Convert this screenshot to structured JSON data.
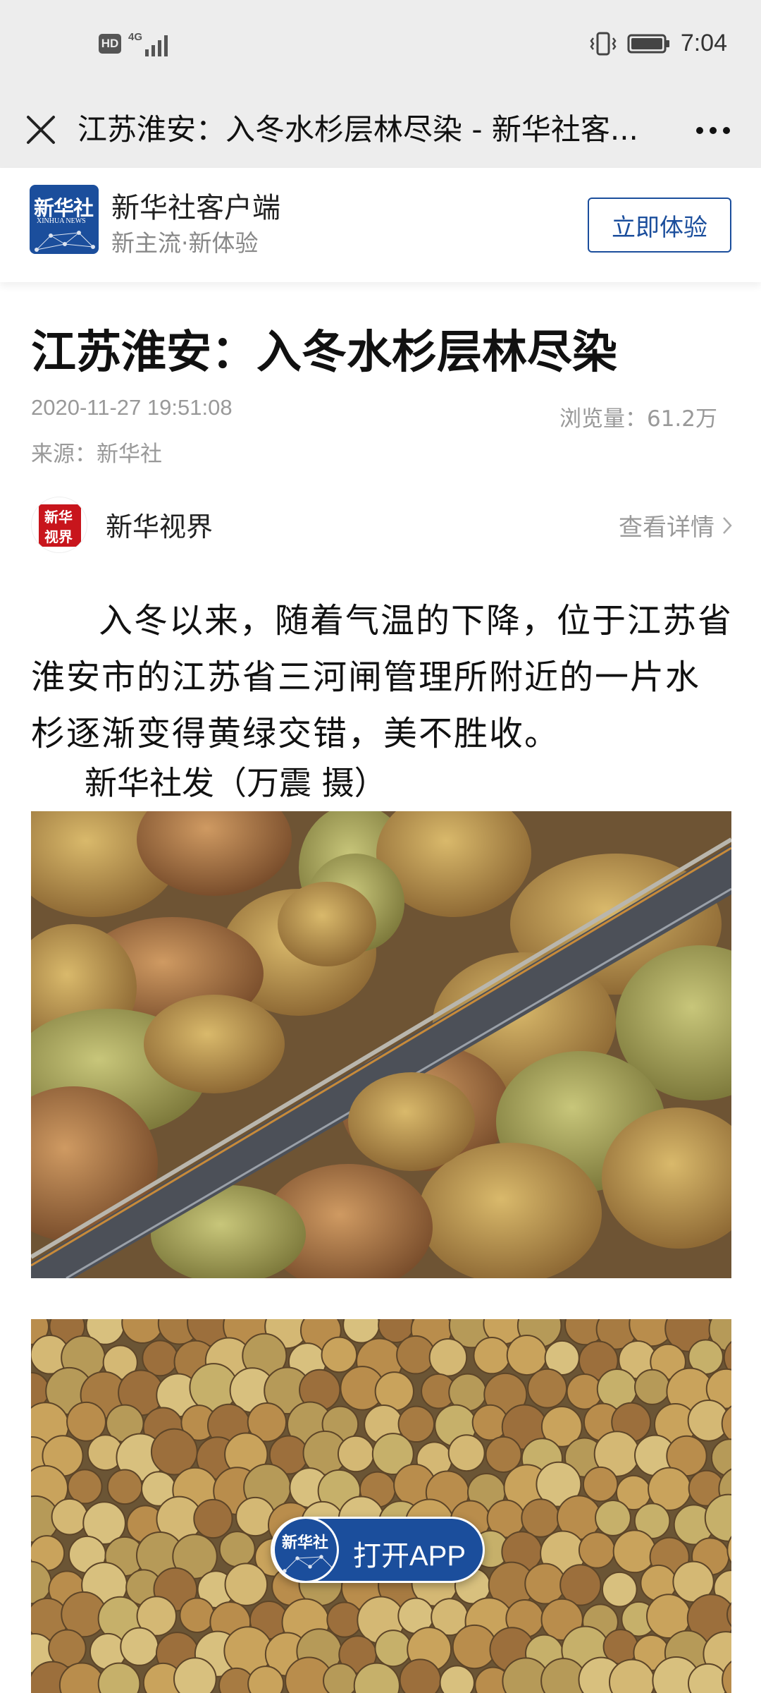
{
  "status_bar": {
    "hd": "HD",
    "network": "4G",
    "time": "7:04"
  },
  "title_bar": {
    "title": "江苏淮安：入冬水杉层林尽染 - 新华社客..."
  },
  "app_banner": {
    "logo_text": "新华社",
    "logo_subtext": "XINHUA NEWS",
    "app_name": "新华社客户端",
    "slogan": "新主流·新体验",
    "cta_label": "立即体验",
    "brand_color": "#1b4e9c"
  },
  "article": {
    "headline": "江苏淮安：入冬水杉层林尽染",
    "pub_time": "2020-11-27 19:51:08",
    "views": "浏览量：61.2万",
    "source": "来源：新华社",
    "author": {
      "logo_top": "新华",
      "logo_bottom": "视界",
      "name": "新华视界",
      "detail_label": "查看详情"
    },
    "body": "入冬以来，随着气温的下降，位于江苏省淮安市的江苏省三河闸管理所附近的一片水杉逐渐变得黄绿交错，美不胜收。",
    "credit": "新华社发（万震 摄）"
  },
  "open_app": {
    "logo_text": "新华社",
    "label": "打开APP"
  }
}
